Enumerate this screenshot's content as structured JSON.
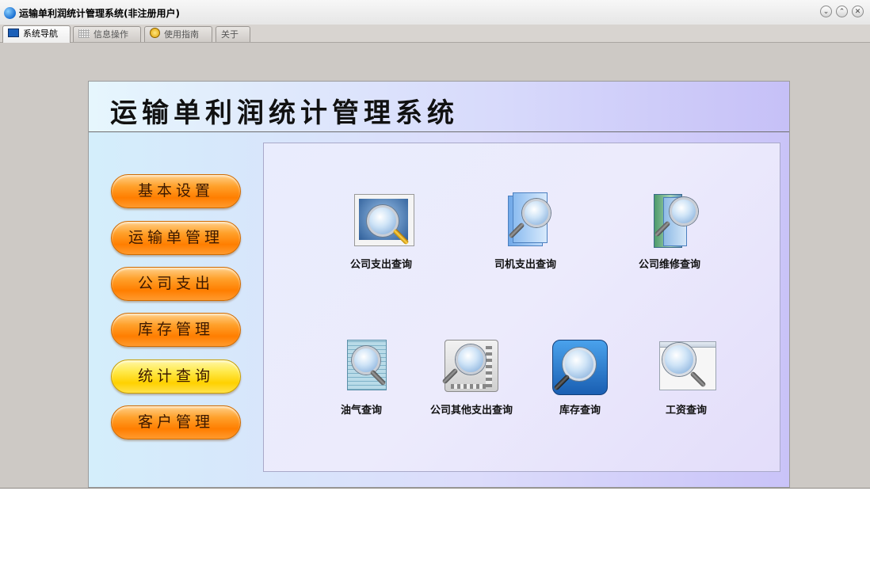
{
  "window": {
    "title": "运输单利润统计管理系统(非注册用户)"
  },
  "tabs": [
    {
      "label": "系统导航",
      "active": true
    },
    {
      "label": "信息操作",
      "active": false
    },
    {
      "label": "使用指南",
      "active": false
    },
    {
      "label": "关于",
      "active": false
    }
  ],
  "panel": {
    "title": "运输单利润统计管理系统"
  },
  "side_buttons": [
    {
      "label": "基本设置"
    },
    {
      "label": "运输单管理"
    },
    {
      "label": "公司支出"
    },
    {
      "label": "库存管理"
    },
    {
      "label": "统计查询",
      "selected": true
    },
    {
      "label": "客户管理"
    }
  ],
  "features": [
    {
      "label": "公司支出查询",
      "icon": "photo-search-icon"
    },
    {
      "label": "司机支出查询",
      "icon": "documents-search-icon"
    },
    {
      "label": "公司维修查询",
      "icon": "folder-search-icon"
    },
    {
      "label": "油气查询",
      "icon": "document-search-icon"
    },
    {
      "label": "公司其他支出查询",
      "icon": "film-search-icon"
    },
    {
      "label": "库存查询",
      "icon": "search-icon"
    },
    {
      "label": "工资查询",
      "icon": "window-search-icon"
    }
  ],
  "colors": {
    "side_button": "#ff8a00",
    "side_button_selected": "#ffe000",
    "panel_bg": "#dcdcfb"
  }
}
